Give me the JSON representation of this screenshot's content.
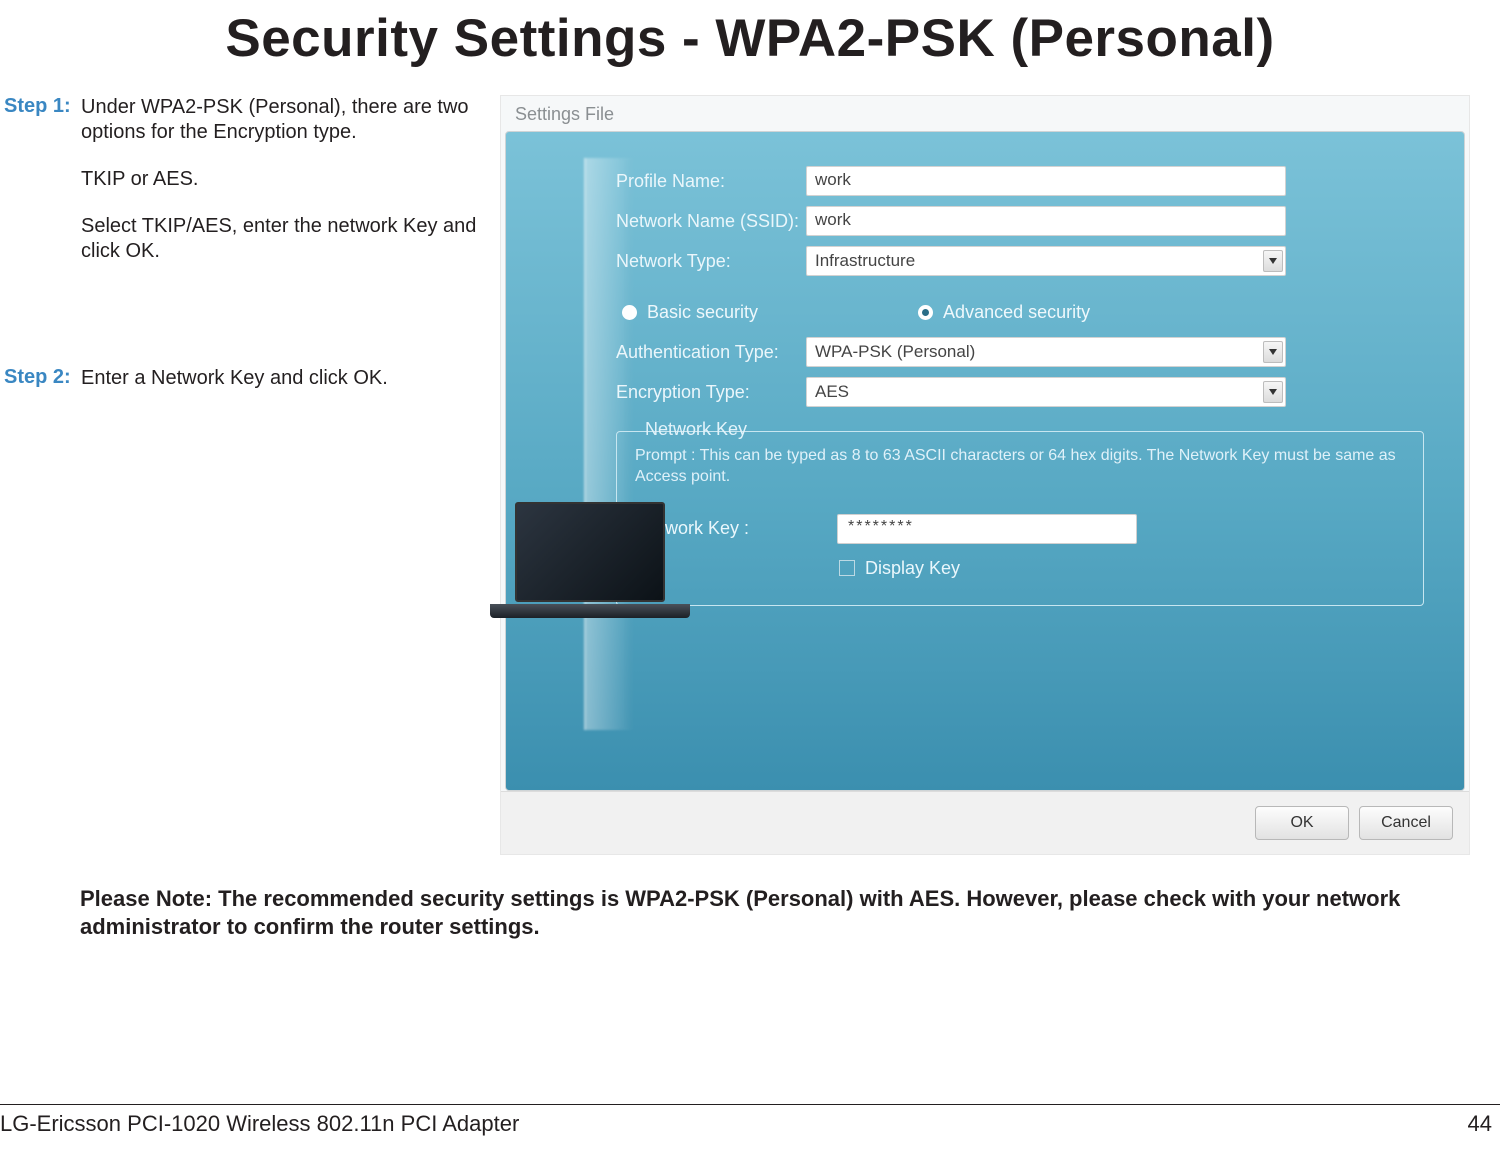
{
  "page": {
    "title": "Security Settings - WPA2-PSK (Personal)",
    "note": "Please Note: The recommended security settings is WPA2-PSK (Personal) with AES. However, please check with your network administrator to confirm the router settings.",
    "footer_product": "LG-Ericsson PCI-1020 Wireless 802.11n PCI Adapter",
    "page_number": "44"
  },
  "steps": {
    "s1_label": "Step 1:",
    "s1_p1": "Under WPA2-PSK (Personal), there are two options for the Encryption type.",
    "s1_p2": "TKIP or AES.",
    "s1_p3": "Select TKIP/AES, enter the network Key and click OK.",
    "s2_label": "Step 2:",
    "s2_p1": "Enter a Network Key and click OK."
  },
  "dialog": {
    "tab": "Settings File",
    "labels": {
      "profile_name": "Profile Name:",
      "ssid": "Network Name (SSID):",
      "net_type": "Network Type:",
      "basic_sec": "Basic security",
      "adv_sec": "Advanced security",
      "auth_type": "Authentication Type:",
      "enc_type": "Encryption Type:",
      "net_key_group": "Network Key",
      "net_key_hint": "Prompt : This can be typed as 8 to 63 ASCII characters or 64 hex digits. The Network Key must be same as Access point.",
      "net_key_label": "Network Key :",
      "display_key": "Display Key"
    },
    "values": {
      "profile_name": "work",
      "ssid": "work",
      "net_type": "Infrastructure",
      "auth_type": "WPA-PSK (Personal)",
      "enc_type": "AES",
      "net_key_masked": "********"
    },
    "buttons": {
      "ok": "OK",
      "cancel": "Cancel"
    }
  }
}
